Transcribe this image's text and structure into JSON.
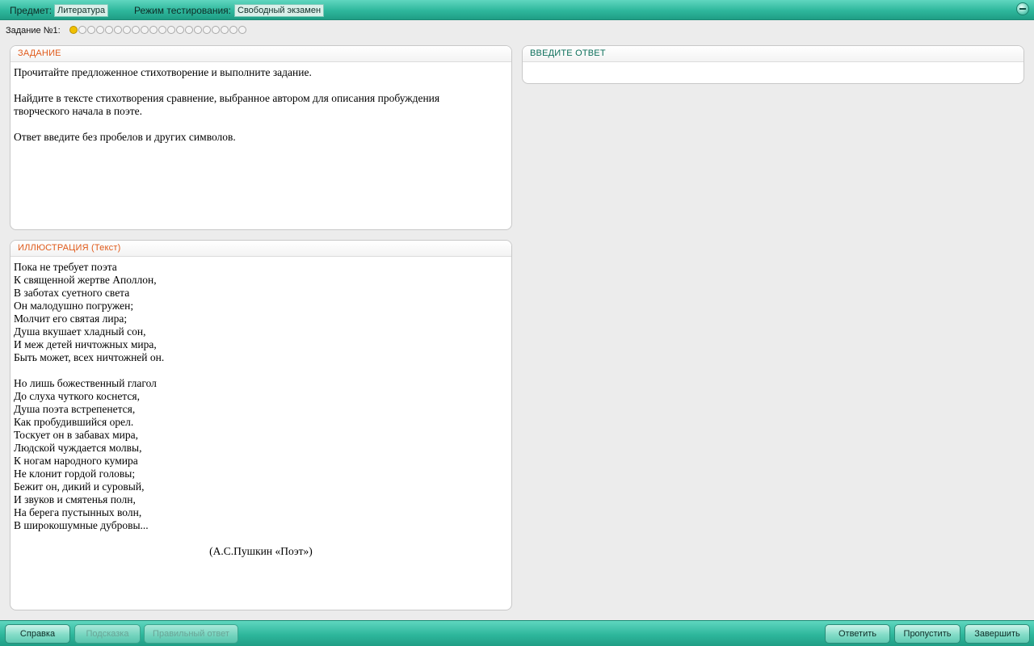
{
  "topbar": {
    "subject_label": "Предмет:",
    "subject_value": "Литература",
    "mode_label": "Режим тестирования:",
    "mode_value": "Свободный экзамен"
  },
  "progress": {
    "label": "Задание №1:",
    "total": 20,
    "current": 1
  },
  "task_panel": {
    "title": "ЗАДАНИЕ",
    "paragraphs": [
      "Прочитайте предложенное стихотворение и выполните задание.",
      "Найдите в тексте стихотворения сравнение, выбранное автором для описания пробуждения творческого начала в поэте.",
      "Ответ введите без пробелов и других символов."
    ]
  },
  "answer_panel": {
    "title": "ВВЕДИТЕ ОТВЕТ",
    "value": ""
  },
  "illustration_panel": {
    "title": "ИЛЛЮСТРАЦИЯ (Текст)",
    "stanza1": [
      "Пока не требует поэта",
      "К священной жертве Аполлон,",
      "В заботах суетного света",
      "Он малодушно погружен;",
      "Молчит его святая лира;",
      "Душа вкушает хладный сон,",
      "И меж детей ничтожных мира,",
      "Быть может, всех ничтожней он."
    ],
    "stanza2": [
      "Но лишь божественный глагол",
      "До слуха чуткого коснется,",
      "Душа поэта встрепенется,",
      "Как пробудившийся орел.",
      "Тоскует он в забавах мира,",
      "Людской чуждается молвы,",
      "К ногам народного кумира",
      "Не клонит гордой головы;",
      "Бежит он, дикий и суровый,",
      "И звуков и смятенья полн,",
      "На берега пустынных волн,",
      "В широкошумные дубровы..."
    ],
    "author": "(А.С.Пушкин «Поэт»)"
  },
  "buttons": {
    "help": "Справка",
    "hint": "Подсказка",
    "correct_answer": "Правильный ответ",
    "answer": "Ответить",
    "skip": "Пропустить",
    "finish": "Завершить"
  },
  "colors": {
    "bar_teal": "#2eb79c",
    "header_orange": "#e05a1a",
    "header_green": "#0d6f5b",
    "active_dot": "#f0c000"
  }
}
